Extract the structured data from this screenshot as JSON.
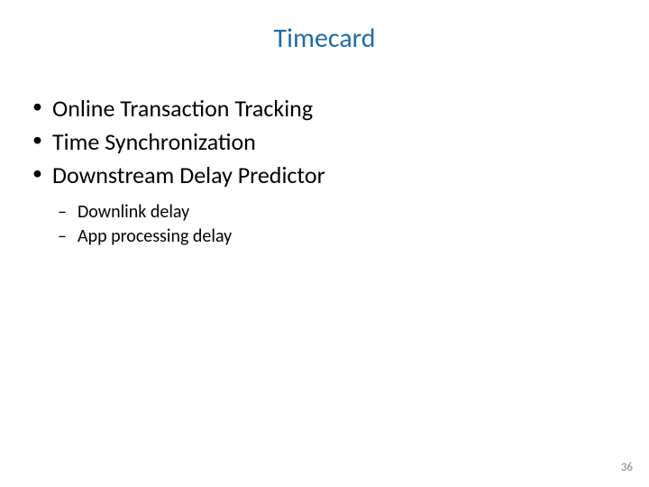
{
  "title": "Timecard",
  "bullets": {
    "item0": "Online Transaction Tracking",
    "item1": "Time Synchronization",
    "item2": "Downstream Delay Predictor"
  },
  "subbullets": {
    "item0": "Downlink delay",
    "item1": "App processing delay"
  },
  "page_number": "36"
}
